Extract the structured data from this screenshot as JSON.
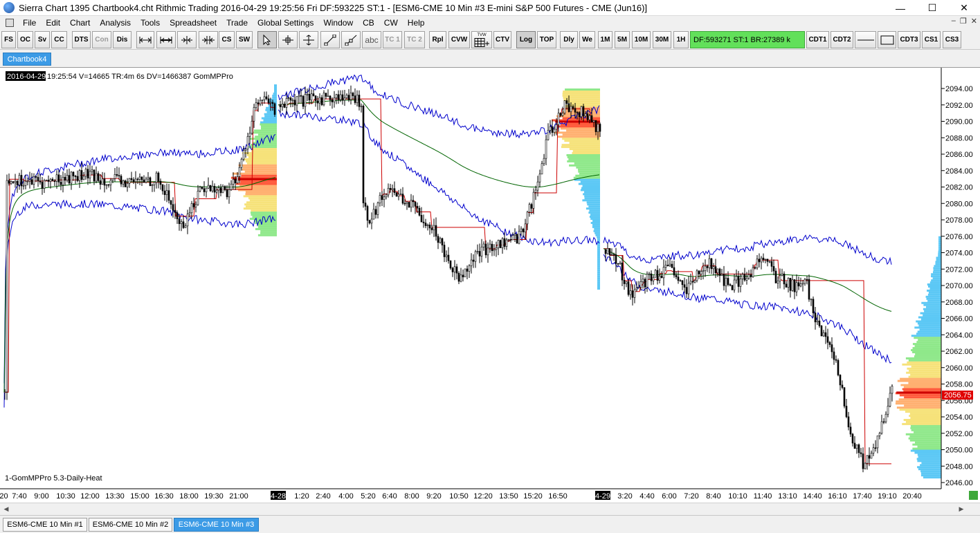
{
  "window": {
    "title": "Sierra Chart 1395 Chartbook4.cht  Rithmic Trading 2016-04-29  19:25:56 Fri  DF:593225  ST:1 - [ESM6-CME  10 Min  #3  E-mini S&P 500 Futures - CME (Jun16)]",
    "minimize": "—",
    "maximize": "☐",
    "close": "✕"
  },
  "menu": {
    "items": [
      "File",
      "Edit",
      "Chart",
      "Analysis",
      "Tools",
      "Spreadsheet",
      "Trade",
      "Global Settings",
      "Window",
      "CB",
      "CW",
      "Help"
    ],
    "mdi_buttons": [
      "–",
      "❐",
      "✕"
    ]
  },
  "toolbar": {
    "buttons": [
      "FS",
      "OC",
      "Sv",
      "CC",
      "DTS",
      "Con",
      "Dis",
      "abc",
      "TC 1",
      "TC 2",
      "Rpl",
      "CVW",
      "CTV",
      "Log",
      "TOP",
      "Dly",
      "We",
      "1M",
      "5M",
      "10M",
      "30M",
      "1H",
      "CDT1",
      "CDT2",
      "CDT3",
      "CS1",
      "CS3"
    ],
    "tvw_label": "TVW",
    "status": "DF:593271  ST:1  BR:27389 k"
  },
  "chartbook_tab": "Chartbook4",
  "chart": {
    "header": {
      "date": "2016-04-29",
      "info": "19:25:54 V=14665 TR:4m 6s DV=1466387  GomMPPro"
    },
    "study_label": "1-GomMPPro 5.3-Daily-Heat",
    "current_price": "2056.75",
    "price_axis": [
      "2094.00",
      "2092.00",
      "2090.00",
      "2088.00",
      "2086.00",
      "2084.00",
      "2082.00",
      "2080.00",
      "2078.00",
      "2076.00",
      "2074.00",
      "2072.00",
      "2070.00",
      "2068.00",
      "2066.00",
      "2064.00",
      "2062.00",
      "2060.00",
      "2058.00",
      "2056.00",
      "2054.00",
      "2052.00",
      "2050.00",
      "2048.00",
      "2046.00"
    ],
    "time_axis": [
      ":20",
      "7:40",
      "9:00",
      "10:30",
      "12:00",
      "13:30",
      "15:00",
      "16:30",
      "18:00",
      "19:30",
      "21:00",
      "4-28",
      "1:20",
      "2:40",
      "4:00",
      "5:20",
      "6:40",
      "8:00",
      "9:20",
      "10:50",
      "12:20",
      "13:50",
      "15:20",
      "16:50",
      "4-29",
      "3:20",
      "4:40",
      "6:00",
      "7:20",
      "8:40",
      "10:10",
      "11:40",
      "13:10",
      "14:40",
      "16:10",
      "17:40",
      "19:10",
      "20:40"
    ],
    "colors": {
      "candle": "#000000",
      "vwap": "#006400",
      "poc": "#cc0000",
      "bands": "#0000cc",
      "price_marker": "#e00000"
    }
  },
  "bottom_tabs": [
    "ESM6-CME  10 Min  #1",
    "ESM6-CME  10 Min  #2",
    "ESM6-CME  10 Min  #3"
  ]
}
